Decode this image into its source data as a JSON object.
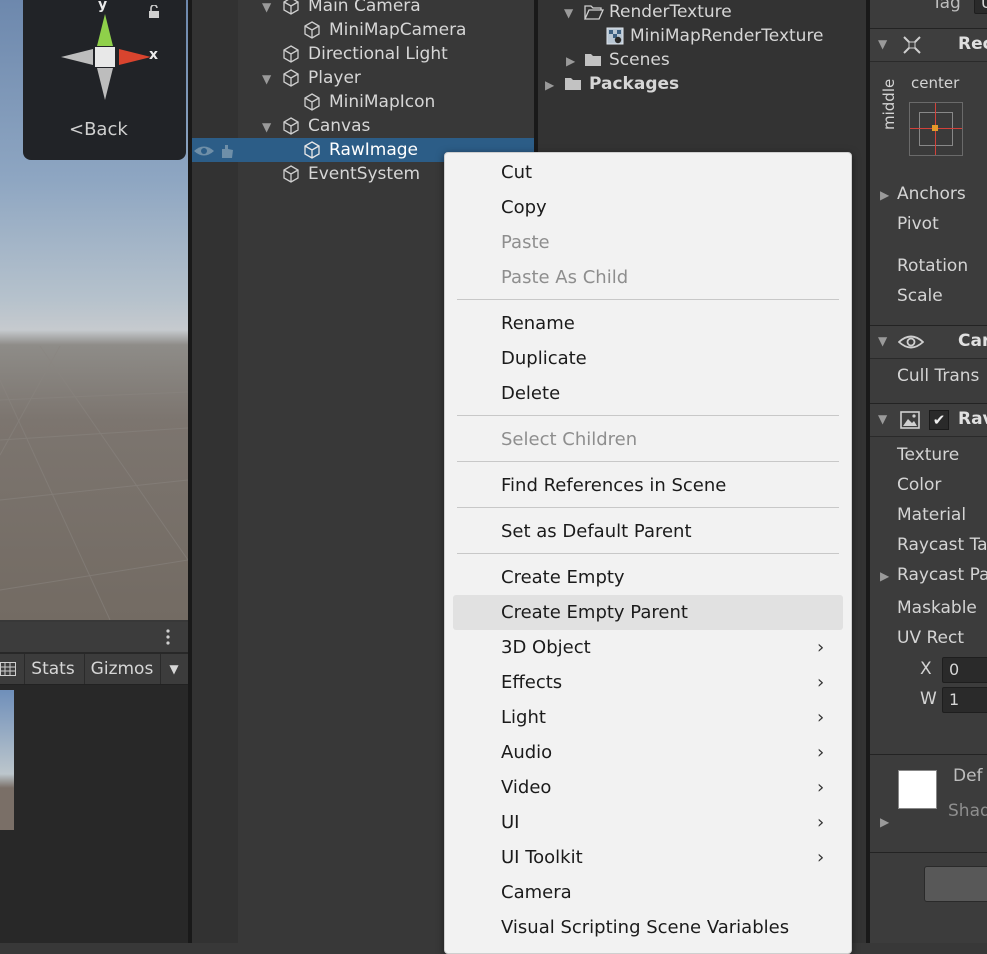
{
  "scene": {
    "gizmo": {
      "axis_y": "y",
      "axis_x": "x",
      "back_label": "<Back",
      "lock_icon": "lock-icon"
    }
  },
  "hierarchy": {
    "items": [
      {
        "label": "Main Camera",
        "expanded": true
      },
      {
        "label": "MiniMapCamera"
      },
      {
        "label": "Directional Light"
      },
      {
        "label": "Player",
        "expanded": true
      },
      {
        "label": "MiniMapIcon"
      },
      {
        "label": "Canvas",
        "expanded": true
      },
      {
        "label": "RawImage",
        "selected": true
      },
      {
        "label": "EventSystem"
      }
    ]
  },
  "project": {
    "items": [
      {
        "label": "RenderTexture",
        "icon": "folder-open-icon"
      },
      {
        "label": "MiniMapRenderTexture",
        "icon": "render-texture-icon"
      },
      {
        "label": "Scenes",
        "icon": "folder-icon"
      },
      {
        "label": "Packages",
        "icon": "folder-icon"
      }
    ]
  },
  "game_toolbar": {
    "stats": "Stats",
    "gizmos": "Gizmos",
    "menu_icon": "kebab-menu-icon"
  },
  "context_menu": {
    "items": [
      {
        "label": "Cut"
      },
      {
        "label": "Copy"
      },
      {
        "label": "Paste",
        "disabled": true
      },
      {
        "label": "Paste As Child",
        "disabled": true
      },
      {
        "label": "Rename"
      },
      {
        "label": "Duplicate"
      },
      {
        "label": "Delete"
      },
      {
        "label": "Select Children",
        "disabled": true
      },
      {
        "label": "Find References in Scene"
      },
      {
        "label": "Set as Default Parent"
      },
      {
        "label": "Create Empty"
      },
      {
        "label": "Create Empty Parent",
        "highlighted": true
      },
      {
        "label": "3D Object",
        "submenu": true
      },
      {
        "label": "Effects",
        "submenu": true
      },
      {
        "label": "Light",
        "submenu": true
      },
      {
        "label": "Audio",
        "submenu": true
      },
      {
        "label": "Video",
        "submenu": true
      },
      {
        "label": "UI",
        "submenu": true
      },
      {
        "label": "UI Toolkit",
        "submenu": true
      },
      {
        "label": "Camera"
      },
      {
        "label": "Visual Scripting Scene Variables"
      }
    ]
  },
  "inspector": {
    "tag_label": "Tag",
    "tag_value": "U",
    "rect_header": "Rec",
    "anchor_preset": {
      "top": "center",
      "side": "middle"
    },
    "anchors": "Anchors",
    "pivot": "Pivot",
    "rotation": "Rotation",
    "scale": "Scale",
    "canvas_renderer_header": "Car",
    "cull_transparent": "Cull Trans",
    "raw_image_header": "Rav",
    "texture": "Texture",
    "color": "Color",
    "material": "Material",
    "raycast_target": "Raycast Ta",
    "raycast_padding": "Raycast Pa",
    "maskable": "Maskable",
    "uv_rect": "UV Rect",
    "uv_x_label": "X",
    "uv_x_value": "0",
    "uv_w_label": "W",
    "uv_w_value": "1",
    "material_default": "Def",
    "material_shader": "Shad"
  },
  "colors": {
    "selection": "#2c5d87",
    "menu_bg": "#f2f2f2",
    "menu_highlight": "#e1e1e1"
  }
}
